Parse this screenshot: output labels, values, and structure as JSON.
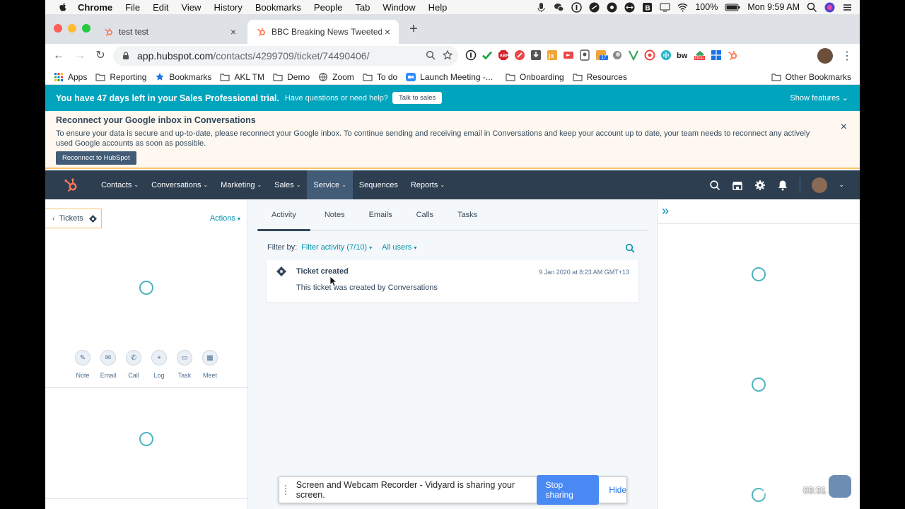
{
  "mac_menubar": {
    "app": "Chrome",
    "menus": [
      "File",
      "Edit",
      "View",
      "History",
      "Bookmarks",
      "People",
      "Tab",
      "Window",
      "Help"
    ],
    "battery": "100%",
    "clock": "Mon 9:59 AM"
  },
  "browser": {
    "tabs": [
      {
        "title": "test test"
      },
      {
        "title": "BBC Breaking News Tweeted: F"
      }
    ],
    "url_host": "app.hubspot.com",
    "url_path": "/contacts/4299709/ticket/74490406/",
    "extension_badge": "17",
    "extension_rec": "REC",
    "bookmarks": [
      "Apps",
      "Reporting",
      "Bookmarks",
      "AKL TM",
      "Demo",
      "Zoom",
      "To do",
      "Launch Meeting -...",
      "Onboarding",
      "Resources"
    ],
    "other_bookmarks": "Other Bookmarks"
  },
  "trial_banner": {
    "message": "You have 47 days left in your Sales Professional trial.",
    "help": "Have questions or need help?",
    "cta": "Talk to sales",
    "show_features": "Show features"
  },
  "reconnect_banner": {
    "title": "Reconnect your Google inbox in Conversations",
    "body": "To ensure your data is secure and up-to-date, please reconnect your Google inbox. To continue sending and receiving email in Conversations and keep your account up to date, your team needs to reconnect any actively used Google accounts as soon as possible.",
    "button": "Reconnect to HubSpot",
    "close": "×"
  },
  "hs_nav": {
    "items": [
      "Contacts",
      "Conversations",
      "Marketing",
      "Sales",
      "Service",
      "Sequences",
      "Reports"
    ],
    "active": "Service"
  },
  "left_panel": {
    "back_label": "Tickets",
    "actions": "Actions",
    "quick_actions": [
      "Note",
      "Email",
      "Call",
      "Log",
      "Task",
      "Meet"
    ]
  },
  "activity": {
    "tabs": [
      "Activity",
      "Notes",
      "Emails",
      "Calls",
      "Tasks"
    ],
    "active_tab": "Activity",
    "filter_by": "Filter by:",
    "filter_activity": "Filter activity (7/10)",
    "all_users": "All users",
    "item": {
      "title": "Ticket created",
      "date": "9 Jan 2020 at 8:23 AM GMT+13",
      "body": "This ticket was created by Conversations"
    }
  },
  "share_bar": {
    "message": "Screen and Webcam Recorder - Vidyard is sharing your screen.",
    "stop": "Stop sharing",
    "hide": "Hide"
  },
  "recorder": {
    "time": "03:31"
  },
  "colors": {
    "trial_teal": "#00a4bd",
    "nav_dark": "#2d3e50",
    "link_teal": "#0091ae",
    "share_blue": "#4a8af4"
  }
}
